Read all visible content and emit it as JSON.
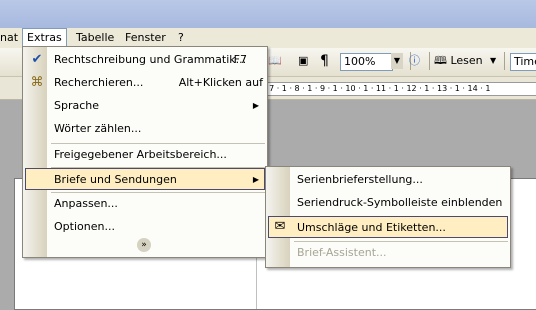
{
  "menubar": {
    "items": [
      "nat",
      "Extras",
      "Tabelle",
      "Fenster",
      "?"
    ]
  },
  "toolbar": {
    "zoom": "100%",
    "read_label": "Lesen",
    "font": "Times"
  },
  "ruler": {
    "marks": "· 7 · 1 · 8 · 1 · 9 · 1 · 10 · 1 · 11 · 1 · 12 · 1 · 13 · 1 · 14 · 1"
  },
  "extras_menu": {
    "items": [
      {
        "label": "Rechtschreibung und Grammatik...",
        "shortcut": "F7"
      },
      {
        "label": "Recherchieren...",
        "shortcut": "Alt+Klicken auf"
      },
      {
        "label": "Sprache"
      },
      {
        "label": "Wörter zählen..."
      },
      {
        "label": "Freigegebener Arbeitsbereich..."
      },
      {
        "label": "Briefe und Sendungen"
      },
      {
        "label": "Anpassen..."
      },
      {
        "label": "Optionen..."
      }
    ],
    "expand_icon": "double-chevron-down"
  },
  "submenu": {
    "items": [
      {
        "label": "Serienbrieferstellung..."
      },
      {
        "label": "Seriendruck-Symbolleiste einblenden"
      },
      {
        "label": "Umschläge und Etiketten..."
      },
      {
        "label": "Brief-Assistent..."
      }
    ]
  },
  "colors": {
    "highlight": "#ffeec2",
    "highlight_border": "#4b4b6f",
    "menubar": "#ece9d8"
  }
}
